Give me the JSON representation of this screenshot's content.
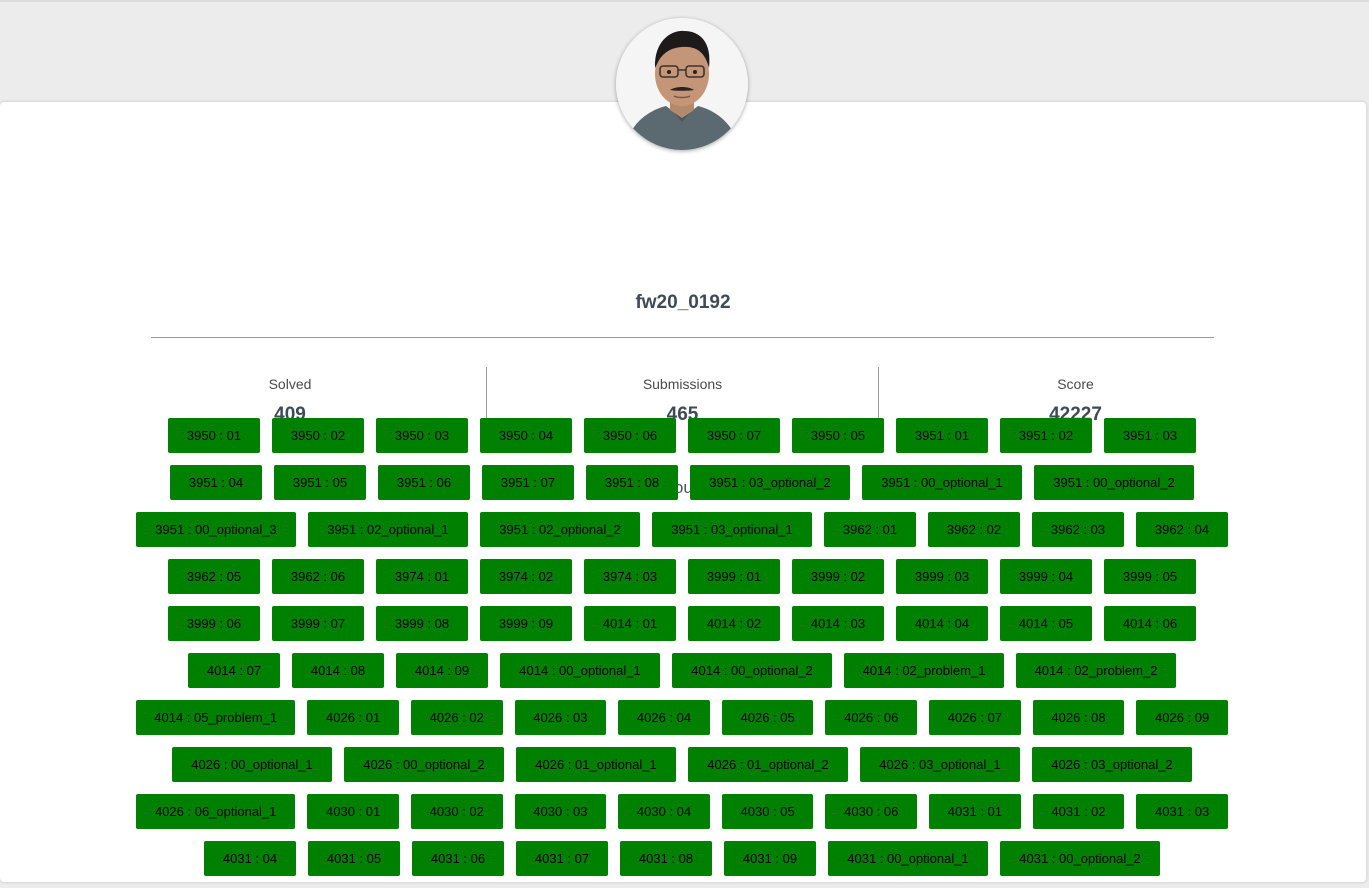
{
  "profile": {
    "username": "fw20_0192"
  },
  "stats": {
    "solved_label": "Solved",
    "solved_value": "409",
    "submissions_label": "Submissions",
    "submissions_value": "465",
    "score_label": "Score",
    "score_value": "42227"
  },
  "problems": {
    "heading": "Problems You Attempted",
    "status_color": "#008000",
    "rows": [
      [
        "3950 : 01",
        "3950 : 02",
        "3950 : 03",
        "3950 : 04",
        "3950 : 06",
        "3950 : 07",
        "3950 : 05",
        "3951 : 01",
        "3951 : 02",
        "3951 : 03"
      ],
      [
        "3951 : 04",
        "3951 : 05",
        "3951 : 06",
        "3951 : 07",
        "3951 : 08",
        "3951 : 03_optional_2",
        "3951 : 00_optional_1",
        "3951 : 00_optional_2"
      ],
      [
        "3951 : 00_optional_3",
        "3951 : 02_optional_1",
        "3951 : 02_optional_2",
        "3951 : 03_optional_1",
        "3962 : 01",
        "3962 : 02",
        "3962 : 03",
        "3962 : 04"
      ],
      [
        "3962 : 05",
        "3962 : 06",
        "3974 : 01",
        "3974 : 02",
        "3974 : 03",
        "3999 : 01",
        "3999 : 02",
        "3999 : 03",
        "3999 : 04",
        "3999 : 05"
      ],
      [
        "3999 : 06",
        "3999 : 07",
        "3999 : 08",
        "3999 : 09",
        "4014 : 01",
        "4014 : 02",
        "4014 : 03",
        "4014 : 04",
        "4014 : 05",
        "4014 : 06"
      ],
      [
        "4014 : 07",
        "4014 : 08",
        "4014 : 09",
        "4014 : 00_optional_1",
        "4014 : 00_optional_2",
        "4014 : 02_problem_1",
        "4014 : 02_problem_2"
      ],
      [
        "4014 : 05_problem_1",
        "4026 : 01",
        "4026 : 02",
        "4026 : 03",
        "4026 : 04",
        "4026 : 05",
        "4026 : 06",
        "4026 : 07",
        "4026 : 08",
        "4026 : 09"
      ],
      [
        "4026 : 00_optional_1",
        "4026 : 00_optional_2",
        "4026 : 01_optional_1",
        "4026 : 01_optional_2",
        "4026 : 03_optional_1",
        "4026 : 03_optional_2"
      ],
      [
        "4026 : 06_optional_1",
        "4030 : 01",
        "4030 : 02",
        "4030 : 03",
        "4030 : 04",
        "4030 : 05",
        "4030 : 06",
        "4031 : 01",
        "4031 : 02",
        "4031 : 03"
      ],
      [
        "4031 : 04",
        "4031 : 05",
        "4031 : 06",
        "4031 : 07",
        "4031 : 08",
        "4031 : 09",
        "4031 : 00_optional_1",
        "4031 : 00_optional_2"
      ]
    ]
  }
}
